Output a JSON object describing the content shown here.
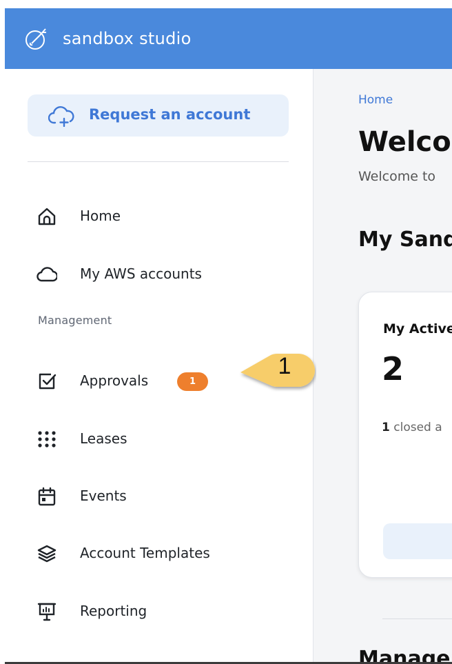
{
  "header": {
    "brand": "sandbox studio"
  },
  "sidebar": {
    "request_button": "Request an account",
    "items": [
      {
        "label": "Home",
        "icon": "home-icon"
      },
      {
        "label": "My AWS accounts",
        "icon": "cloud-icon"
      }
    ],
    "management_label": "Management",
    "management_items": [
      {
        "label": "Approvals",
        "icon": "checkbox-icon",
        "badge": "1"
      },
      {
        "label": "Leases",
        "icon": "dots-grid-icon"
      },
      {
        "label": "Events",
        "icon": "calendar-icon"
      },
      {
        "label": "Account Templates",
        "icon": "layers-icon"
      },
      {
        "label": "Reporting",
        "icon": "presentation-chart-icon"
      }
    ]
  },
  "main": {
    "breadcrumb": "Home",
    "title": "Welcome",
    "subtitle": "Welcome to",
    "section_title": "My Sandbox",
    "card": {
      "title": "My Active",
      "count": "2",
      "note_count": "1",
      "note_text": " closed a"
    },
    "section_title_2": "Management"
  },
  "callout": {
    "number": "1"
  },
  "colors": {
    "header_bg": "#4a89dc",
    "accent": "#3f78d6",
    "badge": "#ee7f2d",
    "callout": "#f7cd6b"
  }
}
